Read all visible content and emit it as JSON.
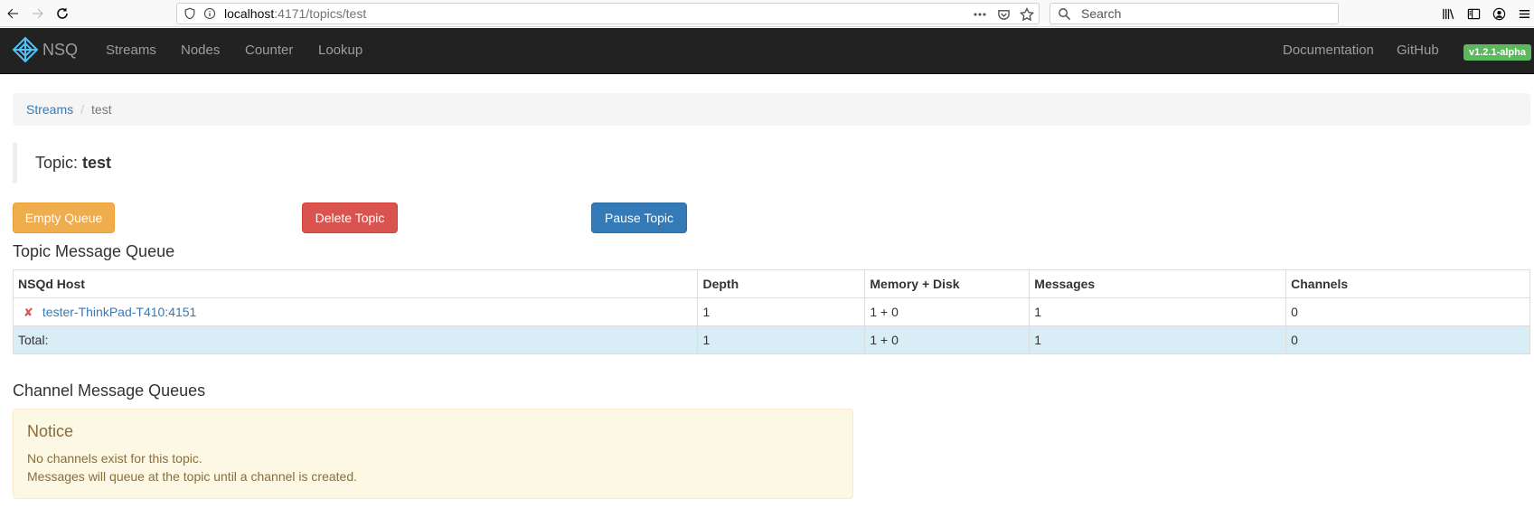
{
  "browser": {
    "url_host": "localhost",
    "url_rest": ":4171/topics/test",
    "search_placeholder": "Search"
  },
  "navbar": {
    "brand": "NSQ",
    "links": [
      "Streams",
      "Nodes",
      "Counter",
      "Lookup"
    ],
    "right_links": [
      "Documentation",
      "GitHub"
    ],
    "version": "v1.2.1-alpha"
  },
  "breadcrumb": {
    "parent": "Streams",
    "separator": "/",
    "current": "test"
  },
  "topic": {
    "label": "Topic:",
    "name": "test"
  },
  "buttons": {
    "empty_queue": "Empty Queue",
    "delete_topic": "Delete Topic",
    "pause_topic": "Pause Topic"
  },
  "topic_queue": {
    "heading": "Topic Message Queue",
    "columns": [
      "NSQd Host",
      "Depth",
      "Memory + Disk",
      "Messages",
      "Channels"
    ],
    "rows": [
      {
        "status_icon": "✘",
        "host": "tester-ThinkPad-T410:4151",
        "depth": "1",
        "memory_disk": "1 + 0",
        "messages": "1",
        "channels": "0"
      }
    ],
    "total": {
      "label": "Total:",
      "depth": "1",
      "memory_disk": "1 + 0",
      "messages": "1",
      "channels": "0"
    }
  },
  "channel_queue": {
    "heading": "Channel Message Queues",
    "notice_title": "Notice",
    "notice_line1": "No channels exist for this topic.",
    "notice_line2": "Messages will queue at the topic until a channel is created."
  },
  "colors": {
    "navbar_bg": "#222222",
    "warning": "#f0ad4e",
    "danger": "#d9534f",
    "primary": "#337ab7",
    "success_badge": "#5cb85c",
    "total_row": "#d9edf7",
    "notice_bg": "#fcf8e3"
  }
}
